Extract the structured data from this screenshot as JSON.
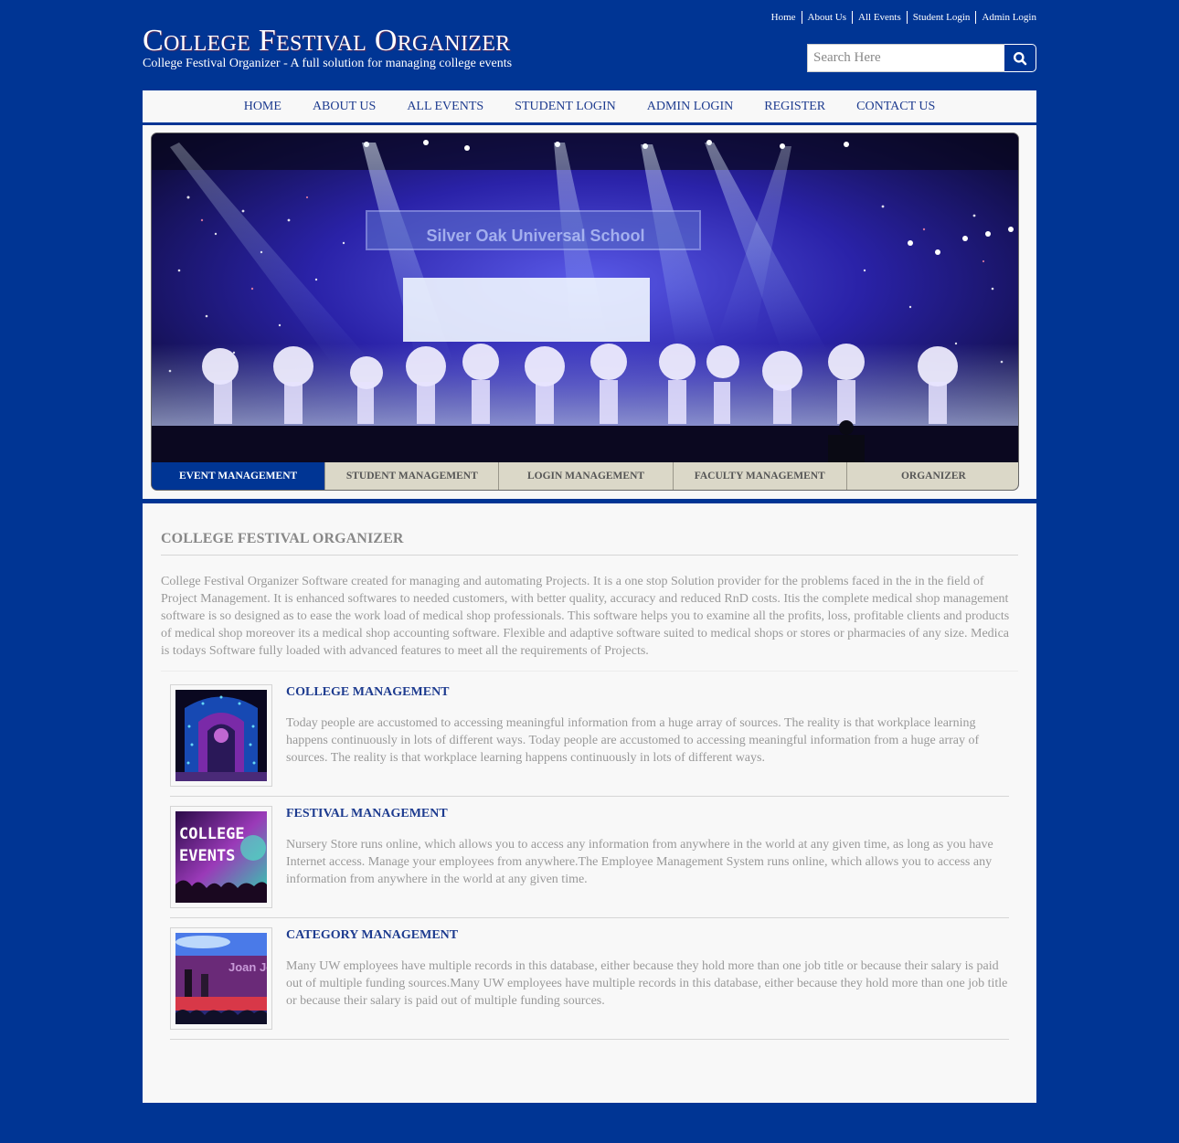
{
  "top_links": [
    "Home",
    "About Us",
    "All Events",
    "Student Login",
    "Admin Login"
  ],
  "logo": {
    "title": "College Festival Organizer",
    "subtitle": "College Festival Organizer - A full solution for managing college events"
  },
  "search": {
    "placeholder": "Search Here",
    "value": "",
    "icon": "search-icon"
  },
  "nav": [
    "HOME",
    "ABOUT US",
    "ALL EVENTS",
    "STUDENT LOGIN",
    "ADMIN LOGIN",
    "REGISTER",
    "CONTACT US"
  ],
  "banner": {
    "image_text": "Silver Oak Universal School",
    "tabs": [
      {
        "label": "EVENT MANAGEMENT",
        "active": true
      },
      {
        "label": "STUDENT MANAGEMENT",
        "active": false
      },
      {
        "label": "LOGIN MANAGEMENT",
        "active": false
      },
      {
        "label": "FACULTY MANAGEMENT",
        "active": false
      },
      {
        "label": "ORGANIZER",
        "active": false
      }
    ]
  },
  "content": {
    "title": "COLLEGE FESTIVAL ORGANIZER",
    "intro": "College Festival Organizer Software created for managing and automating Projects. It is a one stop Solution provider for the problems faced in the in the field of Project Management. It is enhanced softwares to needed customers, with better quality, accuracy and reduced RnD costs. Itis the complete medical shop management software is so designed as to ease the work load of medical shop professionals. This software helps you to examine all the profits, loss, profitable clients and products of medical shop moreover its a medical shop accounting software. Flexible and adaptive software suited to medical shops or stores or pharmacies of any size. Medica is todays Software fully loaded with advanced features to meet all the requirements of Projects.",
    "features": [
      {
        "title": "COLLEGE MANAGEMENT",
        "description": "Today people are accustomed to accessing meaningful information from a huge array of sources. The reality is that workplace learning happens continuously in lots of different ways. Today people are accustomed to accessing meaningful information from a huge array of sources. The reality is that workplace learning happens continuously in lots of different ways."
      },
      {
        "title": "FESTIVAL MANAGEMENT",
        "thumb_text": [
          "COLLEGE",
          "EVENTS"
        ],
        "description": "Nursery Store runs online, which allows you to access any information from anywhere in the world at any given time, as long as you have Internet access. Manage your employees from anywhere.The Employee Management System runs online, which allows you to access any information from anywhere in the world at any given time."
      },
      {
        "title": "CATEGORY MANAGEMENT",
        "thumb_text": [
          "Joan Jett"
        ],
        "description": "Many UW employees have multiple records in this database, either because they hold more than one job title or because their salary is paid out of multiple funding sources.Many UW employees have multiple records in this database, either because they hold more than one job title or because their salary is paid out of multiple funding sources."
      }
    ]
  }
}
